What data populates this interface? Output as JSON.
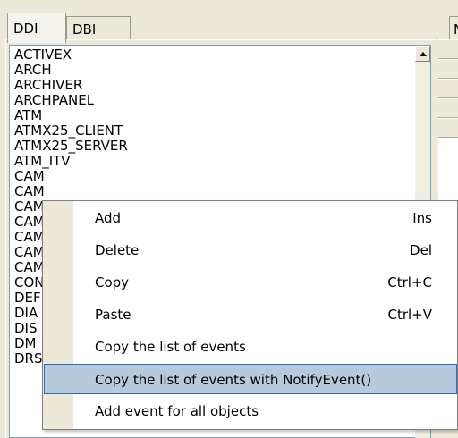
{
  "tabs": [
    {
      "label": "DDI",
      "active": true
    },
    {
      "label": "DBI",
      "active": false
    },
    {
      "label": "N",
      "active": false
    }
  ],
  "list": {
    "items": [
      "ACTIVEX",
      "ARCH",
      "ARCHIVER",
      "ARCHPANEL",
      "ATM",
      "ATMX25_CLIENT",
      "ATMX25_SERVER",
      "ATM_ITV",
      "CAM",
      "CAM",
      "CAM",
      "CAM",
      "CAM",
      "CAM",
      "CAM",
      "CON",
      "DEF",
      "DIA",
      "DIS",
      "DM",
      "DRS"
    ]
  },
  "context_menu": {
    "items": [
      {
        "label": "Add",
        "shortcut": "Ins"
      },
      {
        "label": "Delete",
        "shortcut": "Del"
      },
      {
        "label": "Copy",
        "shortcut": "Ctrl+C"
      },
      {
        "label": "Paste",
        "shortcut": "Ctrl+V"
      },
      {
        "label": "Copy the list of events",
        "shortcut": ""
      },
      {
        "label": "Copy the list of events with NotifyEvent()",
        "shortcut": "",
        "highlighted": true
      },
      {
        "label": "Add event for all objects",
        "shortcut": ""
      }
    ]
  },
  "colors": {
    "menu_highlight": "#b7cadc",
    "menu_highlight_border": "#316ac5",
    "window_background": "#ece9d8"
  }
}
